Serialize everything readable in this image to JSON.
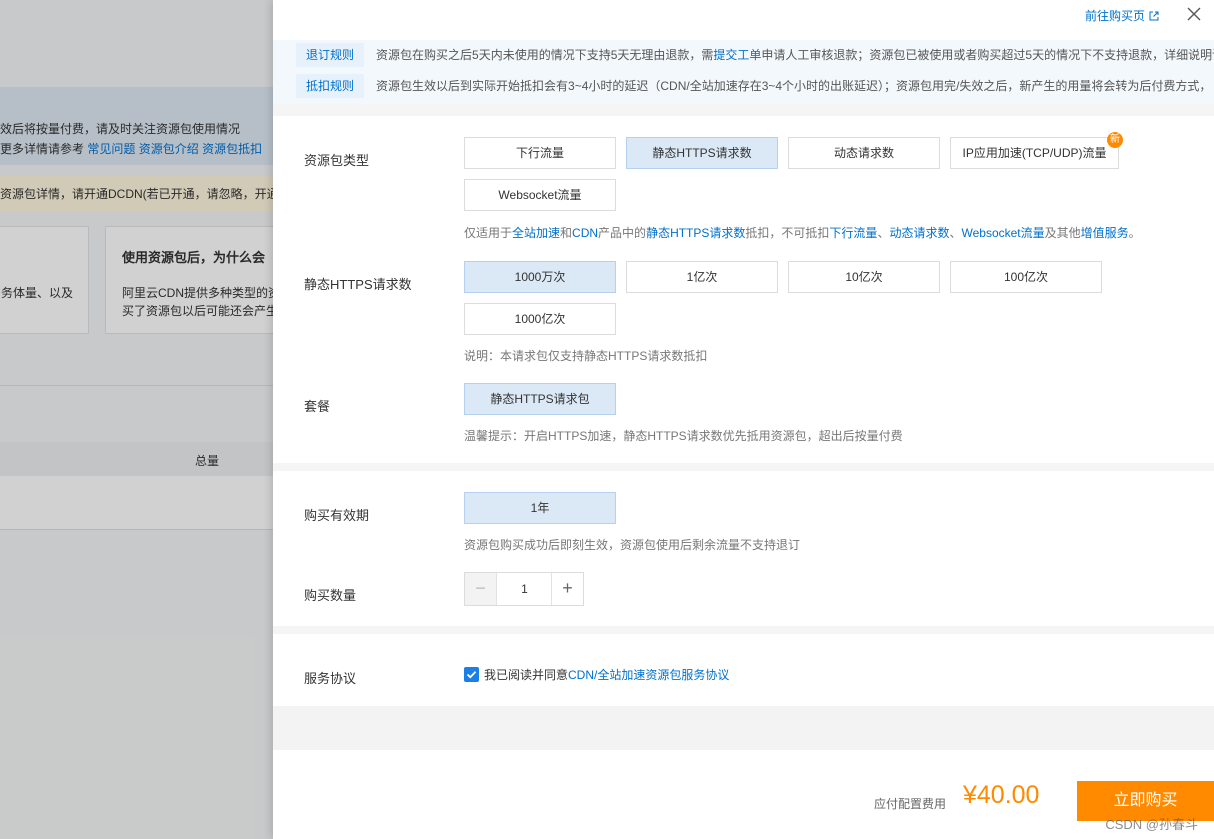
{
  "background": {
    "info_line1": "效后将按量付费，请及时关注资源包使用情况",
    "info_line2_prefix": "更多详情请参考",
    "info_links": [
      "常见问题",
      "资源包介绍",
      "资源包抵扣"
    ],
    "warn_text": "资源包详情，请开通DCDN(若已开通，请忽略，开通",
    "card1_text": "务体量、以及",
    "card2_title": "使用资源包后，为什么会",
    "card2_line1": "阿里云CDN提供多种类型的资",
    "card2_line2": "买了资源包以后可能还会产生",
    "table_header": "总量"
  },
  "drawer": {
    "top_link": "前往购买页",
    "rules": [
      {
        "tag": "退订规则",
        "text_before": "资源包在购买之后5天内未使用的情况下支持5天无理由退款，需",
        "link": "提交工单",
        "text_after": "申请人工审核退款；资源包已被使用或者购买超过5天的情况下不支持退款，详细说明请"
      },
      {
        "tag": "抵扣规则",
        "text_before": "资源包生效以后到实际开始抵扣会有3~4小时的延迟（CDN/全站加速存在3~4个小时的出账延迟）；资源包用完/失效之后，新产生的用量将会转为后付费方式，",
        "link": "",
        "text_after": ""
      }
    ],
    "package_type": {
      "label": "资源包类型",
      "options": [
        "下行流量",
        "静态HTTPS请求数",
        "动态请求数",
        "IP应用加速(TCP/UDP)流量",
        "Websocket流量"
      ],
      "selected": "静态HTTPS请求数",
      "new_badge": "新",
      "hint": {
        "t1": "仅适用于",
        "l1": "全站加速",
        "t2": "和",
        "l2": "CDN",
        "t3": "产品中的",
        "l3": "静态HTTPS请求数",
        "t4": "抵扣，不可抵扣",
        "l4": "下行流量",
        "t5": "、",
        "l5": "动态请求数",
        "t6": "、",
        "l6": "Websocket流量",
        "t7": "及其他",
        "l7": "增值服务",
        "t8": "。"
      }
    },
    "https_count": {
      "label": "静态HTTPS请求数",
      "options": [
        "1000万次",
        "1亿次",
        "10亿次",
        "100亿次",
        "1000亿次"
      ],
      "selected": "1000万次",
      "hint": "说明：本请求包仅支持静态HTTPS请求数抵扣"
    },
    "plan": {
      "label": "套餐",
      "options": [
        "静态HTTPS请求包"
      ],
      "hint": "温馨提示：开启HTTPS加速，静态HTTPS请求数优先抵用资源包，超出后按量付费"
    },
    "validity": {
      "label": "购买有效期",
      "options": [
        "1年"
      ],
      "hint": "资源包购买成功后即刻生效，资源包使用后剩余流量不支持退订"
    },
    "quantity": {
      "label": "购买数量",
      "value": "1",
      "minus": "−",
      "plus": "+"
    },
    "agreement": {
      "label": "服务协议",
      "text": "我已阅读并同意",
      "link": "CDN/全站加速资源包服务协议",
      "checked": true
    },
    "footer": {
      "fee_label": "应付配置费用",
      "price": "¥40.00",
      "buy_label": "立即购买"
    },
    "watermark": "CSDN @孙春斗"
  },
  "colors": {
    "accent": "#0070cc",
    "selected_bg": "#dbe9f6",
    "price": "#ff8a00",
    "checkbox": "#1c7fe6"
  }
}
